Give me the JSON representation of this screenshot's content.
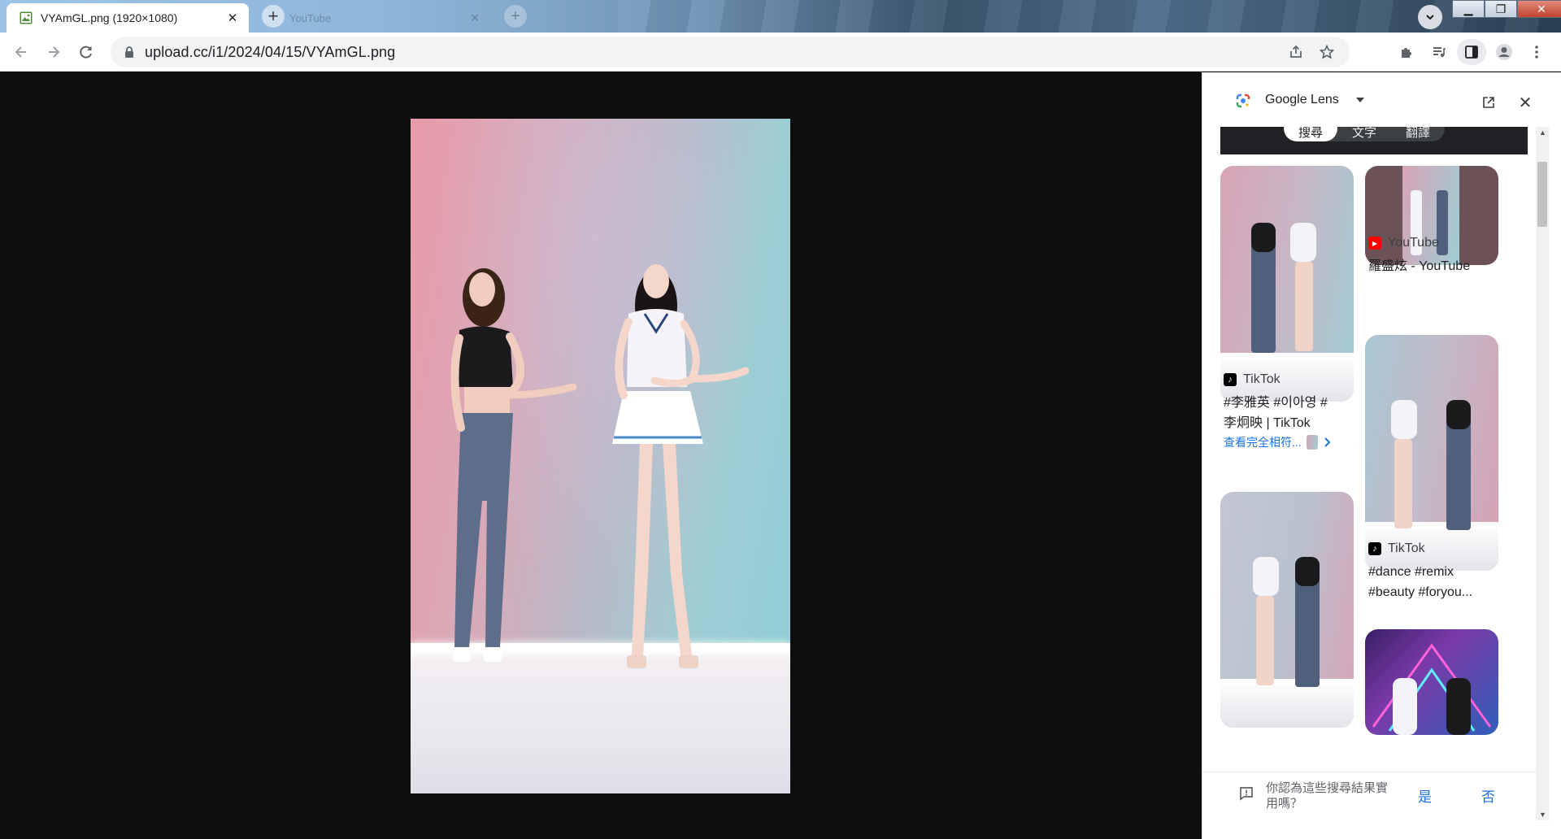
{
  "tabs": {
    "active_title": "VYAmGL.png (1920×1080)",
    "ghost_title": "YouTube",
    "close_glyph": "✕",
    "new_tab_glyph": "+"
  },
  "window": {
    "minimize_glyph": "▁",
    "restore_glyph": "❐",
    "close_glyph": "✕"
  },
  "omnibox": {
    "url": "upload.cc/i1/2024/04/15/VYAmGL.png"
  },
  "lens": {
    "title": "Google Lens",
    "close_glyph": "✕",
    "modes": [
      "搜尋",
      "文字",
      "翻譯"
    ],
    "results": [
      {
        "source": "TikTok",
        "desc_line1": "#李雅英 #이아영 #",
        "desc_line2": "李炯映 | TikTok",
        "more": "查看完全相符..."
      },
      {
        "source": "YouTube",
        "desc_line1": "羅盛炫 - YouTube",
        "desc_line2": ""
      },
      {
        "source": "TikTok",
        "desc_line1": "#dance #remix",
        "desc_line2": "#beauty #foryou..."
      }
    ],
    "feedback": {
      "question": "你認為這些搜尋結果實用嗎？",
      "yes": "是",
      "no": "否"
    }
  },
  "colors": {
    "accent": "#1a73e8",
    "youtube": "#ff0000",
    "tiktok": "#000000"
  }
}
